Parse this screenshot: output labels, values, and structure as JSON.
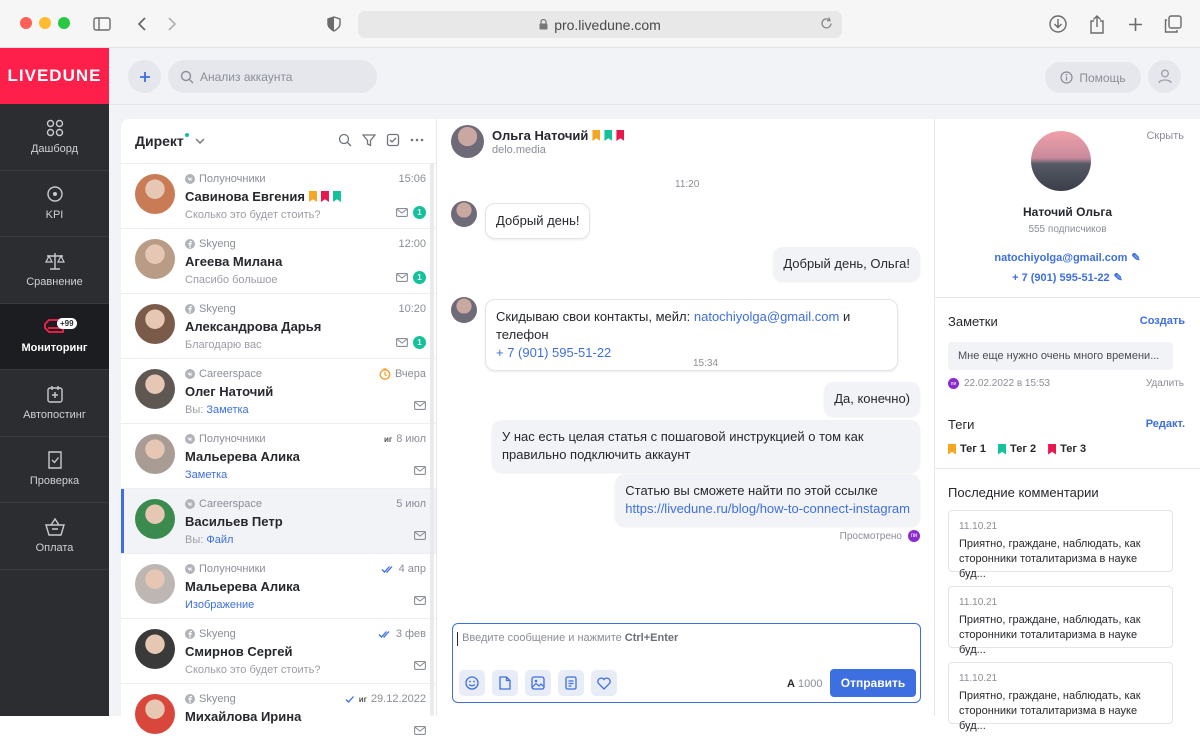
{
  "browser": {
    "url": "pro.livedune.com"
  },
  "sidebar": {
    "logo": "LIVEDUNE",
    "items": [
      {
        "label": "Дашборд",
        "icon": "dashboard-icon"
      },
      {
        "label": "KPI",
        "icon": "target-icon"
      },
      {
        "label": "Сравнение",
        "icon": "scales-icon"
      },
      {
        "label": "Мониторинг",
        "icon": "monitoring-icon",
        "badge": "+99",
        "active": true
      },
      {
        "label": "Автопостинг",
        "icon": "autopost-icon"
      },
      {
        "label": "Проверка",
        "icon": "check-icon"
      },
      {
        "label": "Оплата",
        "icon": "basket-icon"
      }
    ]
  },
  "topbar": {
    "search_placeholder": "Анализ аккаунта",
    "help_label": "Помощь"
  },
  "list": {
    "title": "Директ",
    "conversations": [
      {
        "source": "Полуночники",
        "name": "Савинова Евгения",
        "preview": "Сколько это будет стоить?",
        "time": "15:06",
        "unread": "1",
        "flags": [
          "#f5a623",
          "#e8174d",
          "#12c29a"
        ],
        "avatar": "#c97b55"
      },
      {
        "source": "Skyeng",
        "name": "Агеева Милана",
        "preview": "Спасибо большое",
        "time": "12:00",
        "unread": "1",
        "avatar": "#b89c86"
      },
      {
        "source": "Skyeng",
        "name": "Александрова Дарья",
        "preview": "Благодарю вас",
        "time": "10:20",
        "unread": "1",
        "avatar": "#7a5a48"
      },
      {
        "source": "Careerspace",
        "name": "Олег Наточий",
        "preview_prefix": "Вы:",
        "preview_link": "Заметка",
        "time": "Вчера",
        "avatar": "#5f5752"
      },
      {
        "source": "Полуночники",
        "name": "Мальерева Алика",
        "preview_link": "Заметка",
        "time": "8 июл",
        "time_badge": "иг",
        "avatar": "#a89c95"
      },
      {
        "source": "Careerspace",
        "name": "Васильев Петр",
        "preview_prefix": "Вы:",
        "preview_link": "Файл",
        "time": "5 июл",
        "selected": true,
        "avatar": "#3b8a4e"
      },
      {
        "source": "Полуночники",
        "name": "Мальерева Алика",
        "preview_link": "Изображение",
        "time": "4 апр",
        "avatar": "#bdb6b2"
      },
      {
        "source": "Skyeng",
        "name": "Смирнов Сергей",
        "preview": "Сколько это будет стоить?",
        "time": "3 фев",
        "avatar": "#3a3a3a"
      },
      {
        "source": "Skyeng",
        "name": "Михайлова Ирина",
        "preview": "",
        "time": "29.12.2022",
        "time_badge": "иг",
        "avatar": "#d9463c"
      }
    ]
  },
  "chat": {
    "header_name": "Ольга Наточий",
    "header_sub": "delo.media",
    "flags": [
      "#f5a623",
      "#12c29a",
      "#e8174d"
    ],
    "stamp1": "11:20",
    "stamp2": "15:34",
    "m1": "Добрый день!",
    "m2": "Добрый день, Ольга!",
    "m3_text": "Скидываю свои контакты, мейл:",
    "m3_email": "natochiyolga@gmail.com",
    "m3_mid": "и телефон",
    "m3_phone": "+ 7 (901) 595-51-22",
    "m4": "Да, конечно)",
    "m5": "У нас есть целая статья с пошаговой инструкцией о том как правильно подключить аккаунт",
    "m6_text": "Статью вы сможете найти по этой ссылке",
    "m6_link": "https://livedune.ru/blog/how-to-connect-instagram",
    "seen": "Просмотрено",
    "seen_badge": "пи",
    "composer_placeholder": "Введите сообщение и нажмите",
    "composer_hotkey": "Ctrl+Enter",
    "counter_a": "A",
    "counter_val": "1000",
    "send": "Отправить"
  },
  "profile": {
    "hide": "Скрыть",
    "name": "Наточий Ольга",
    "subscribers": "555 подписчиков",
    "email": "natochiyolga@gmail.com",
    "phone": "+ 7 (901) 595-51-22",
    "notes_title": "Заметки",
    "notes_action": "Создать",
    "note_text": "Мне еще нужно очень много времени...",
    "note_badge": "пи",
    "note_date": "22.02.2022 в 15:53",
    "note_delete": "Удалить",
    "tags_title": "Теги",
    "tags_action": "Редакт.",
    "tags": [
      {
        "label": "Тег 1",
        "color": "#f5a623"
      },
      {
        "label": "Тег 2",
        "color": "#12c29a"
      },
      {
        "label": "Тег 3",
        "color": "#e8174d"
      }
    ],
    "comments_title": "Последние комментарии",
    "comments": [
      {
        "date": "11.10.21",
        "text": "Приятно, граждане, наблюдать, как сторонники тоталитаризма в науке буд..."
      },
      {
        "date": "11.10.21",
        "text": "Приятно, граждане, наблюдать, как сторонники тоталитаризма в науке буд..."
      },
      {
        "date": "11.10.21",
        "text": "Приятно, граждане, наблюдать, как сторонники тоталитаризма в науке буд..."
      }
    ]
  }
}
